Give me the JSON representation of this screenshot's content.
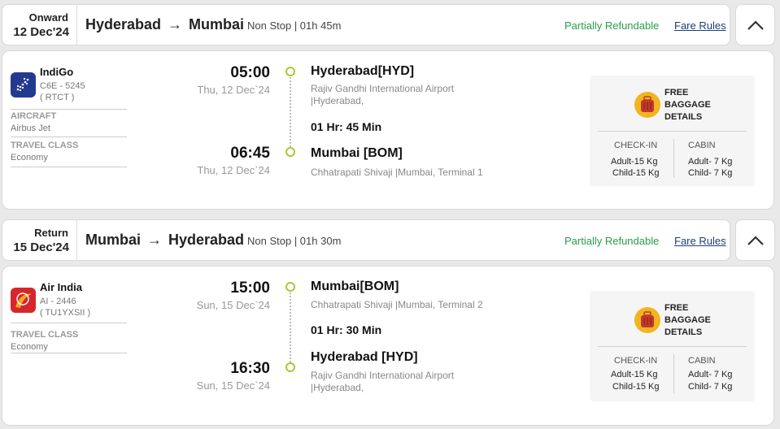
{
  "colors": {
    "accent_green": "#2a9d48",
    "link_blue": "#1c3f7a",
    "timeline_dot": "#a7c934",
    "indigo_logo": "#233a8f",
    "airindia_logo": "#d7262b",
    "baggage_icon": "#f2b51f"
  },
  "onward": {
    "header": {
      "kind": "Onward",
      "date": "12 Dec'24",
      "from": "Hyderabad",
      "arrow": "→",
      "to": "Mumbai",
      "meta": "Non Stop | 01h 45m",
      "refund": "Partially Refundable",
      "fare_rules": "Fare Rules",
      "toggle_icon": "chevron-up-icon"
    },
    "airline": {
      "name": "IndiGo",
      "flight_no": "C6E - 5245",
      "fare_code": "( RTCT )",
      "logo_icon": "indigo-logo-icon",
      "aircraft_label": "AIRCRAFT",
      "aircraft": "Airbus Jet",
      "class_label": "TRAVEL CLASS",
      "class": "Economy"
    },
    "depart": {
      "time": "05:00",
      "date": "Thu, 12 Dec`24",
      "city": "Hyderabad[HYD]",
      "airport_line1": "Rajiv Gandhi International Airport",
      "airport_line2": "|Hyderabad,"
    },
    "duration": "01 Hr: 45 Min",
    "arrive": {
      "time": "06:45",
      "date": "Thu, 12 Dec`24",
      "city": "Mumbai [BOM]",
      "airport_line1": "Chhatrapati Shivaji |Mumbai, Terminal 1"
    },
    "baggage": {
      "title_lines": [
        "FREE",
        "BAGGAGE",
        "DETAILS"
      ],
      "checkin_label": "CHECK-IN",
      "cabin_label": "CABIN",
      "checkin_adult": "Adult-15 Kg",
      "checkin_child": "Child-15 Kg",
      "cabin_adult": "Adult- 7 Kg",
      "cabin_child": "Child- 7 Kg",
      "icon": "luggage-icon"
    }
  },
  "return": {
    "header": {
      "kind": "Return",
      "date": "15 Dec'24",
      "from": "Mumbai",
      "arrow": "→",
      "to": "Hyderabad",
      "meta": "Non Stop | 01h 30m",
      "refund": "Partially Refundable",
      "fare_rules": "Fare Rules",
      "toggle_icon": "chevron-up-icon"
    },
    "airline": {
      "name": "Air India",
      "flight_no": "AI - 2446",
      "fare_code": "( TU1YXSII )",
      "logo_icon": "air-india-logo-icon",
      "class_label": "TRAVEL CLASS",
      "class": "Economy"
    },
    "depart": {
      "time": "15:00",
      "date": "Sun, 15 Dec`24",
      "city": "Mumbai[BOM]",
      "airport_line1": "Chhatrapati Shivaji |Mumbai, Terminal 2"
    },
    "duration": "01 Hr: 30 Min",
    "arrive": {
      "time": "16:30",
      "date": "Sun, 15 Dec`24",
      "city": "Hyderabad [HYD]",
      "airport_line1": "Rajiv Gandhi International Airport",
      "airport_line2": "|Hyderabad,"
    },
    "baggage": {
      "title_lines": [
        "FREE",
        "BAGGAGE",
        "DETAILS"
      ],
      "checkin_label": "CHECK-IN",
      "cabin_label": "CABIN",
      "checkin_adult": "Adult-15 Kg",
      "checkin_child": "Child-15 Kg",
      "cabin_adult": "Adult- 7 Kg",
      "cabin_child": "Child- 7 Kg",
      "icon": "luggage-icon"
    }
  }
}
